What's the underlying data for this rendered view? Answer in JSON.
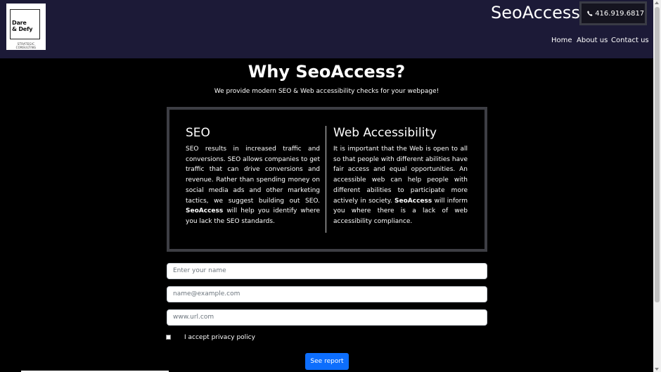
{
  "header": {
    "logo": {
      "line1": "Dare",
      "line2": "& Defy",
      "sub1": "STRATEGIC",
      "sub2": "CONSULTING"
    },
    "brand": "SeoAccess",
    "phone": "416.919.6817",
    "phone_icon": "phone-icon",
    "nav": [
      "Home",
      "About us",
      "Contact us"
    ]
  },
  "hero": {
    "title": "Why SeoAccess?",
    "subtitle": "We provide modern SEO & Web accessibility checks for your webpage!"
  },
  "cards": {
    "seo": {
      "title": "SEO",
      "text_before": "SEO results in increased traffic and conversions. SEO allows companies to get traffic that can drive conversions and revenue. Rather than spending money on social media ads and other marketing tactics, we suggest building out SEO. ",
      "strong": "SeoAccess",
      "text_after": " will help you identify where you lack the SEO standards."
    },
    "accessibility": {
      "title": "Web Accessibility",
      "text_before": "It is important that the Web is open to all so that people with different abilities have fair access and equal opportunities. An accessible web can help people with different abilities to participate more actively in society. ",
      "strong": "SeoAccess",
      "text_after": " will inform you where there is a lack of web accessibility compliance."
    }
  },
  "form": {
    "name_placeholder": "Enter your name",
    "email_placeholder": "name@example.com",
    "url_placeholder": "www.url.com",
    "privacy_label": "I accept privacy policy",
    "submit_label": "See report"
  },
  "colors": {
    "header_bg": "#1c1a37",
    "page_bg": "#000000",
    "button_bg": "#0d6efd"
  }
}
